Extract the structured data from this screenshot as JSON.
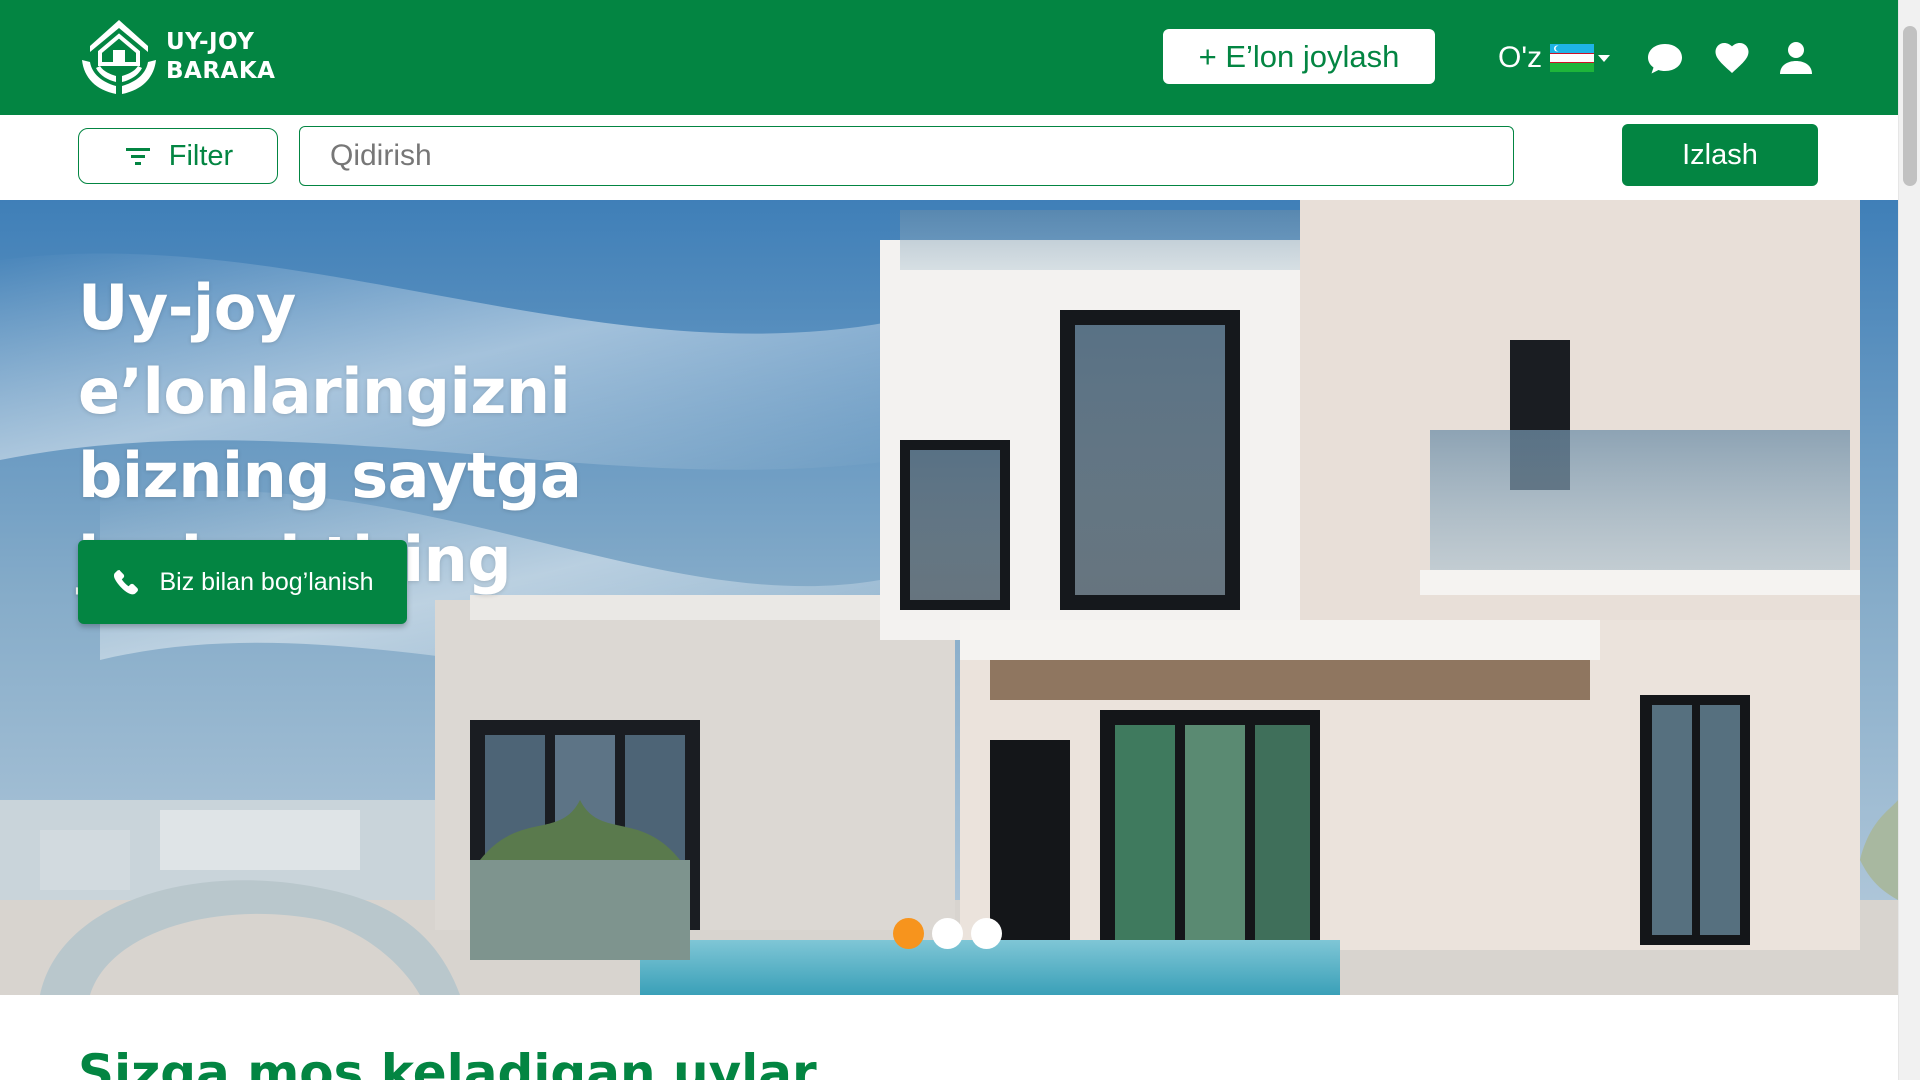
{
  "header": {
    "logo": {
      "line1": "UY-JOY",
      "line2": "BARAKA"
    },
    "post_ad_label": "+ E’lon joylash",
    "language": {
      "selected": "O'z",
      "flag_icon": "uzbekistan-flag-icon"
    },
    "icons": {
      "chat": "chat-bubble-icon",
      "favorites": "heart-icon",
      "profile": "user-icon"
    }
  },
  "search": {
    "filter_label": "Filter",
    "placeholder": "Qidirish",
    "value": "",
    "submit_label": "Izlash"
  },
  "hero": {
    "title": "Uy-joy e’lonlaringizni bizning saytga joylashtiring",
    "contact_label": "Biz bilan bog’lanish",
    "slides_total": 3,
    "active_slide": 1
  },
  "main": {
    "section_title": "Sizga mos keladigan uylar"
  },
  "colors": {
    "brand_green": "#038542",
    "accent_orange": "#f7941d",
    "white": "#ffffff"
  }
}
